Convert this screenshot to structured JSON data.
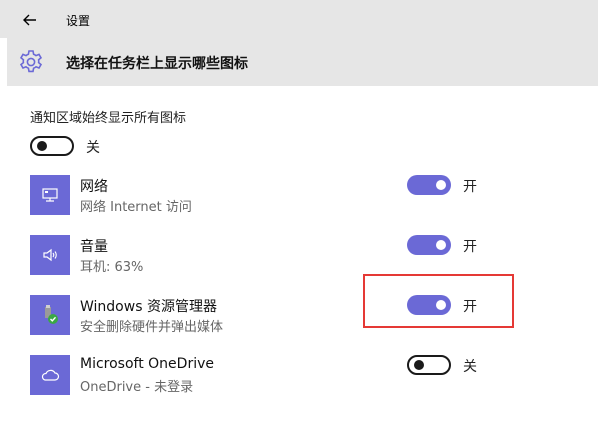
{
  "window": {
    "title": "设置"
  },
  "header": {
    "title": "选择在任务栏上显示哪些图标"
  },
  "always_show": {
    "label": "通知区域始终显示所有图标",
    "state": "关",
    "on": false
  },
  "apps": [
    {
      "name": "网络",
      "subtitle": "网络 Internet 访问",
      "state": "开",
      "on": true,
      "icon": "network-monitor-icon"
    },
    {
      "name": "音量",
      "subtitle": "耳机: 63%",
      "state": "开",
      "on": true,
      "icon": "speaker-icon"
    },
    {
      "name": "Windows 资源管理器",
      "subtitle": "安全删除硬件并弹出媒体",
      "state": "开",
      "on": true,
      "icon": "usb-eject-icon"
    },
    {
      "name": "Microsoft OneDrive",
      "subtitle": "OneDrive - 未登录",
      "state": "关",
      "on": false,
      "icon": "cloud-icon"
    }
  ],
  "colors": {
    "accent": "#6b69d6",
    "highlight": "#e53935",
    "header_bg": "#e6e6e6"
  }
}
